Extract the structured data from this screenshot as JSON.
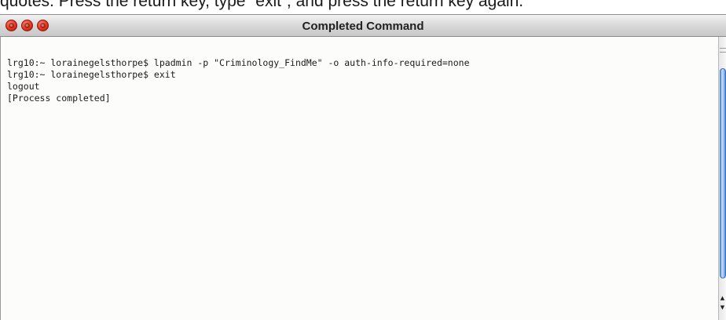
{
  "caption": {
    "text": "quotes. Press the return key, type “exit”, and press the return key again."
  },
  "window": {
    "title": "Completed Command",
    "buttons": {
      "close_icon": "close-icon",
      "minimize_icon": "minimize-icon",
      "zoom_icon": "zoom-icon",
      "button_color": "#e8331f"
    }
  },
  "terminal": {
    "lines": [
      "lrg10:~ lorainegelsthorpe$ lpadmin -p \"Criminology_FindMe\" -o auth-info-required=none",
      "lrg10:~ lorainegelsthorpe$ exit",
      "logout",
      "[Process completed]"
    ],
    "text_color": "#1b1b1b",
    "background_color": "#fcfcfa"
  },
  "scrollbar": {
    "thumb_color": "#6fa3e6",
    "up_arrow": "▲",
    "down_arrow": "▼"
  }
}
